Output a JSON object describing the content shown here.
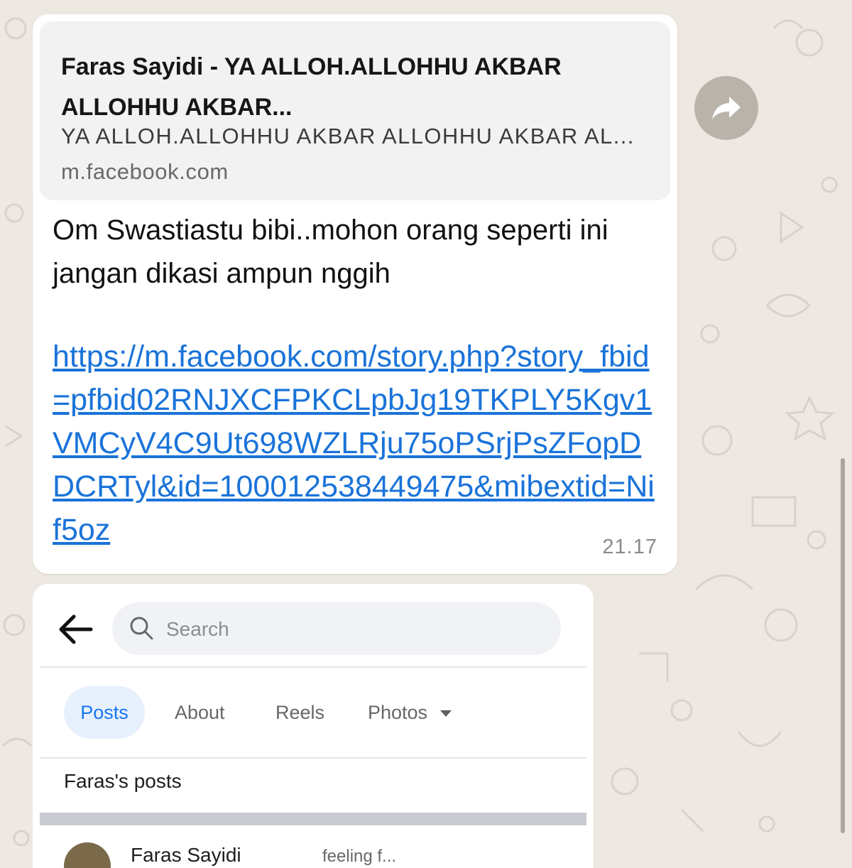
{
  "link_preview": {
    "title": "Faras Sayidi - YA ALLOH.ALLOHHU AKBAR ALLOHHU AKBAR...",
    "description": "YA ALLOH.ALLOHHU AKBAR ALLOHHU AKBAR AL...",
    "domain": "m.facebook.com"
  },
  "message": {
    "text": "Om Swastiastu bibi..mohon orang seperti ini jangan dikasi ampun nggih",
    "link": "https://m.facebook.com/story.php?story_fbid=pfbid02RNJXCFPKCLpbJg19TKPLY5Kgv1VMCyV4C9Ut698WZLRju75oPSrjPsZFopDDCRTyl&id=100012538449475&mibextid=Nif5oz",
    "time": "21.17"
  },
  "forward_icon": "share-forward-icon",
  "screenshot_card": {
    "search_placeholder": "Search",
    "tabs": [
      {
        "label": "Posts",
        "active": true
      },
      {
        "label": "About"
      },
      {
        "label": "Reels"
      },
      {
        "label": "Photos"
      }
    ],
    "posts_header": "Faras's posts",
    "post_author": "Faras Sayidi",
    "post_meta": "feeling f..."
  },
  "colors": {
    "chat_background": "#ede8e1",
    "bubble": "#ffffff",
    "link": "#1a73d9",
    "active_tab": "#1877f2"
  }
}
